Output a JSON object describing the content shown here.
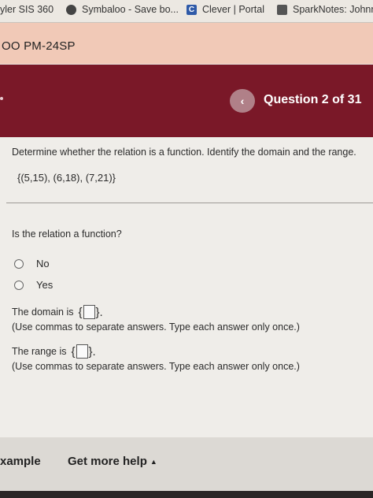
{
  "bookmarks": [
    {
      "label": "yler SIS 360",
      "icon": "none"
    },
    {
      "label": "Symbaloo - Save bo...",
      "icon": "symbaloo-icon"
    },
    {
      "label": "Clever | Portal",
      "icon": "clever-icon",
      "icon_text": "C"
    },
    {
      "label": "SparkNotes: Johnn",
      "icon": "sparknotes-icon"
    }
  ],
  "course": {
    "title": "OO PM-24SP"
  },
  "question_nav": {
    "prev_symbol": "‹",
    "counter": "Question 2 of 31"
  },
  "question": {
    "prompt": "Determine whether the relation is a function. Identify the domain and the range.",
    "relation": "{(5,15), (6,18), (7,21)}",
    "subquestion": "Is the relation a function?",
    "options": [
      "No",
      "Yes"
    ],
    "domain": {
      "label": "The domain is",
      "open": "{",
      "close": "}.",
      "hint": "(Use commas to separate answers. Type each answer only once.)"
    },
    "range": {
      "label": "The range is",
      "open": "{",
      "close": "}.",
      "hint": "(Use commas to separate answers. Type each answer only once.)"
    }
  },
  "footer": {
    "example_label": "xample",
    "help_label": "Get more help",
    "help_caret": "▲"
  },
  "colors": {
    "header": "#7a1828",
    "course_strip": "#f1c9b7",
    "content_bg": "#efede9"
  }
}
